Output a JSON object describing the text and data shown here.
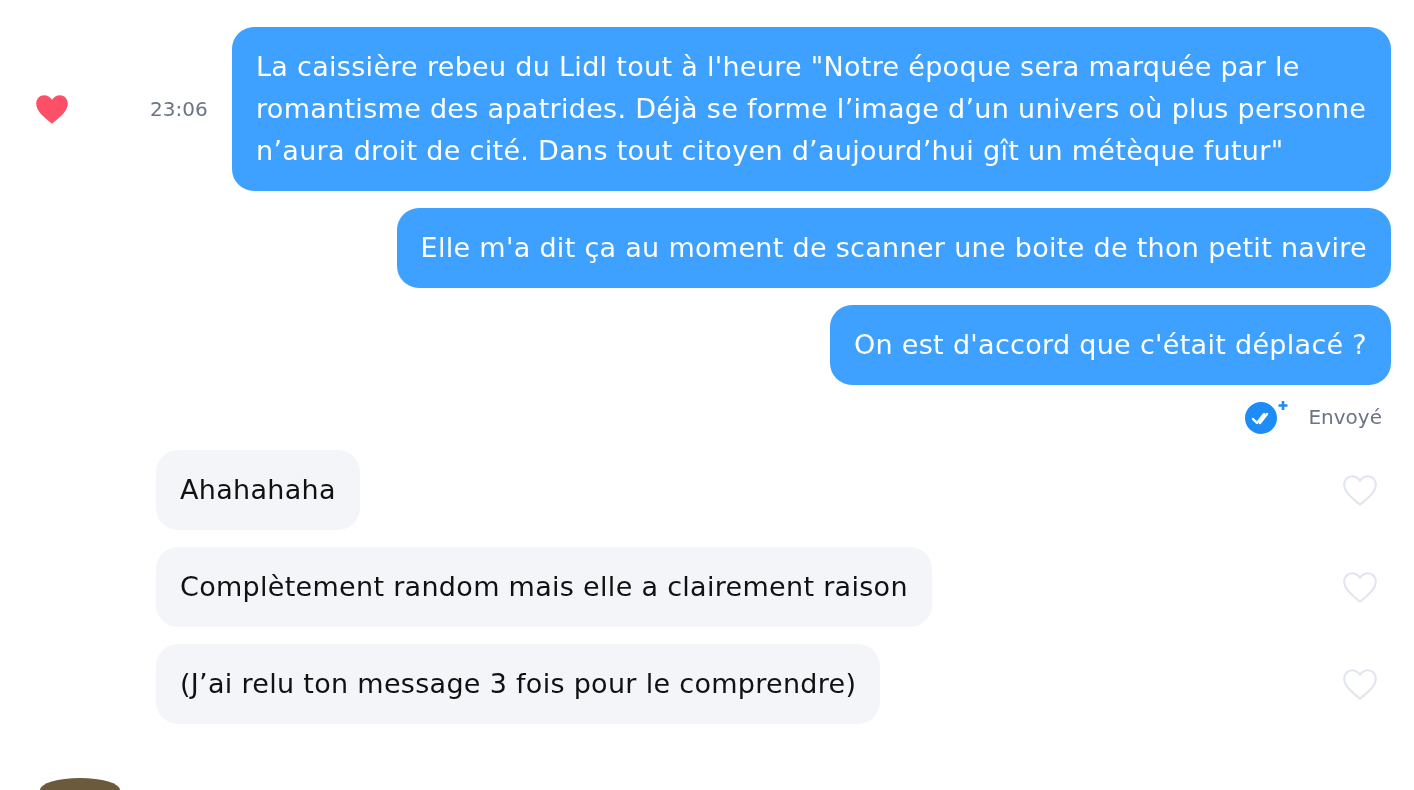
{
  "messages": [
    {
      "kind": "sent",
      "text": "La caissière rebeu du Lidl tout à l'heure \"Notre époque sera marquée par le romantisme des apatrides. Déjà se forme l’image d’un univers où plus personne n’aura droit de cité. Dans tout citoyen d’aujourd’hui gît un métèque futur\"",
      "time": "23:06",
      "liked": true
    },
    {
      "kind": "sent",
      "text": "Elle m'a dit ça au moment de scanner une boite de thon petit navire"
    },
    {
      "kind": "sent",
      "text": "On est d'accord que c'était déplacé ?"
    },
    {
      "kind": "receipt",
      "text": "Envoyé"
    },
    {
      "kind": "received",
      "text": "Ahahahaha",
      "liked": false
    },
    {
      "kind": "received",
      "text": "Complètement random mais elle a clairement raison",
      "liked": false
    },
    {
      "kind": "received",
      "text": "(J’ai relu ton message 3 fois pour le comprendre)",
      "liked": false
    }
  ]
}
